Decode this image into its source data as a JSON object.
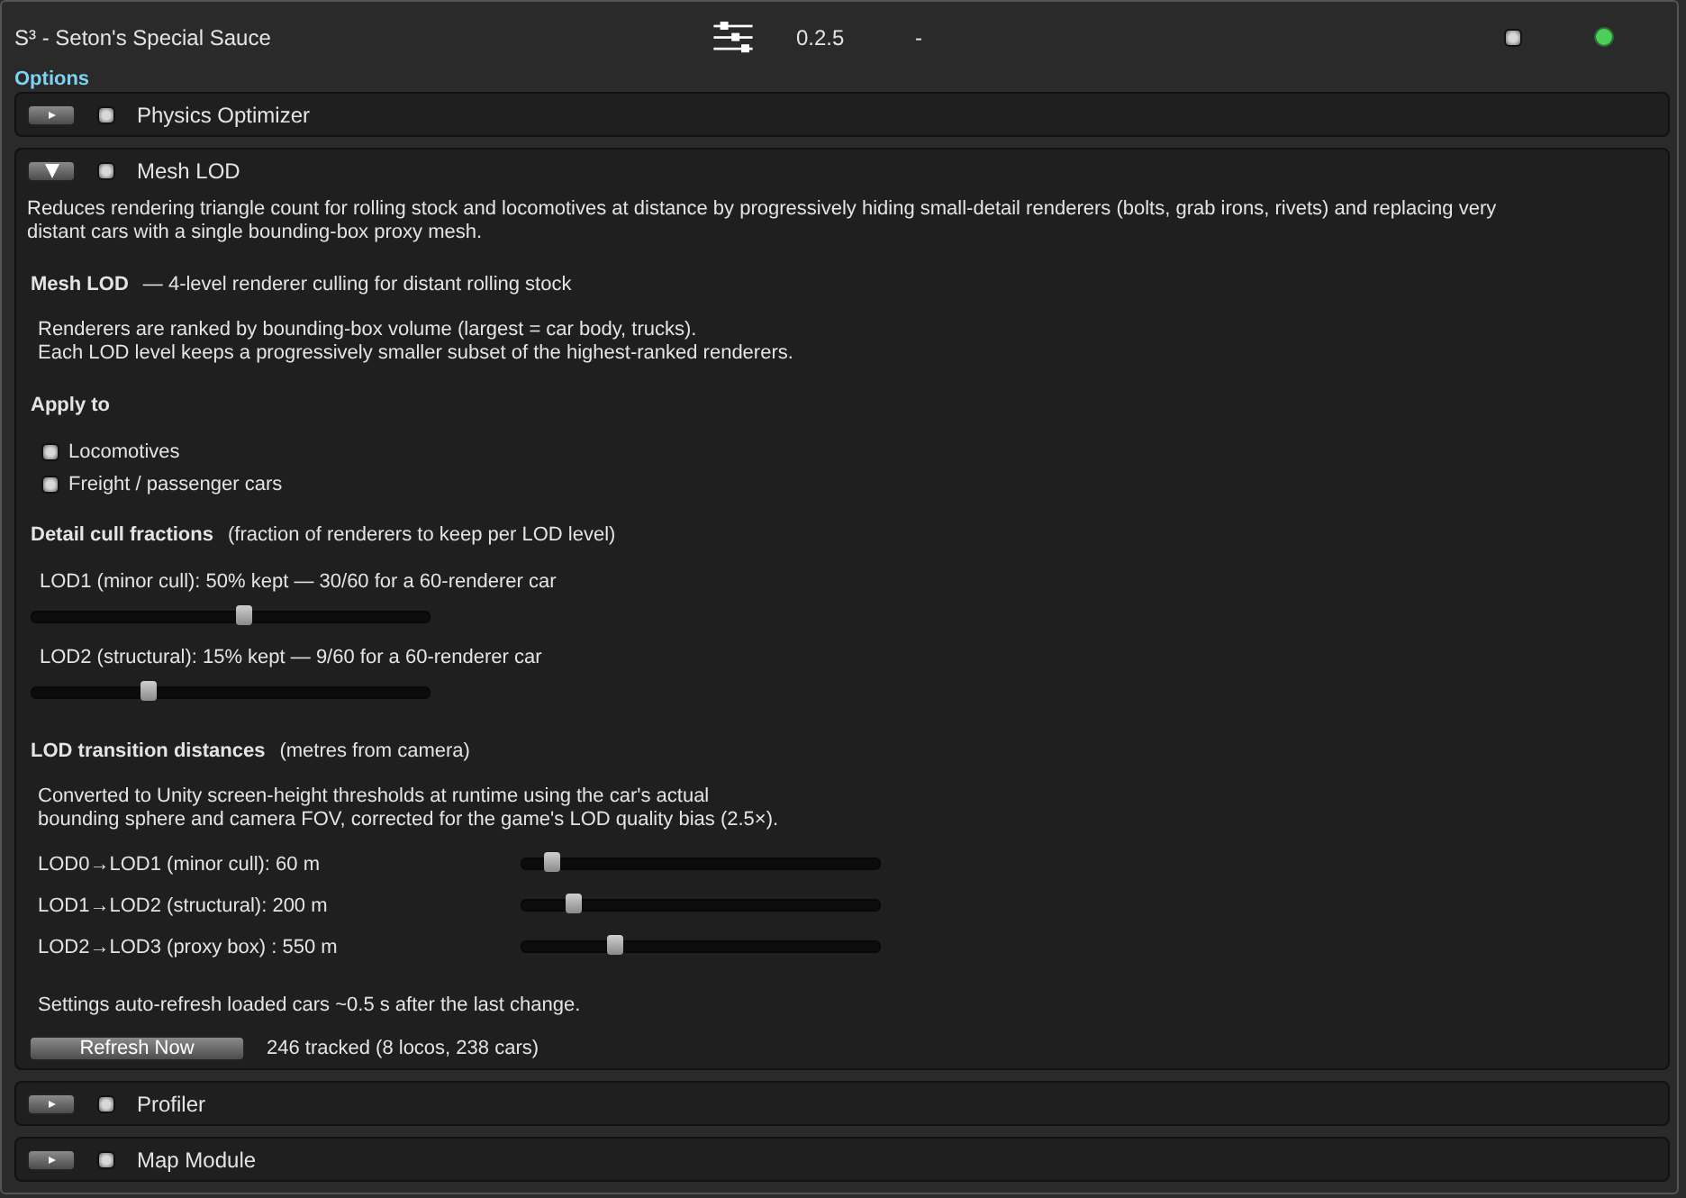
{
  "mod": {
    "title": "S³ - Seton's Special Sauce",
    "version": "0.2.5",
    "column_4": "-",
    "enabled": true,
    "active": true
  },
  "options_label": "Options",
  "sections": [
    {
      "title": "Physics Optimizer",
      "expanded": false,
      "enabled": true
    },
    {
      "title": "Mesh LOD",
      "expanded": true,
      "enabled": true,
      "description": "Reduces rendering triangle count for rolling stock and locomotives at distance by progressively hiding small-detail renderers (bolts, grab irons, rivets) and replacing very distant cars with a single bounding-box proxy mesh.",
      "content": {
        "heading": {
          "title": "Mesh LOD",
          "subtitle": "— 4-level renderer culling for distant rolling stock"
        },
        "notes": [
          "Renderers are ranked by bounding-box volume (largest = car body, trucks).",
          "Each LOD level keeps a progressively smaller subset of the highest-ranked renderers."
        ],
        "apply_to": {
          "title": "Apply to",
          "options": [
            {
              "label": "Locomotives",
              "checked": true
            },
            {
              "label": "Freight / passenger cars",
              "checked": true
            }
          ]
        },
        "cull": {
          "title": "Detail cull fractions",
          "subtitle": "(fraction of renderers to keep per LOD level)",
          "sliders": [
            {
              "label": "LOD1 (minor cull):  50% kept — 30/60 for a 60-renderer car",
              "level": 0.54
            },
            {
              "label": "LOD2 (structural):  15% kept — 9/60 for a 60-renderer car",
              "level": 0.3
            }
          ]
        },
        "distances": {
          "title": "LOD transition distances",
          "subtitle": "(metres from camera)",
          "notes": [
            "Converted to Unity screen-height thresholds at runtime using the car's actual",
            "bounding sphere and camera FOV, corrected for the game's LOD quality bias (2.5×)."
          ],
          "sliders": [
            {
              "label": "LOD0→LOD1  (minor cull):  60 m",
              "level": 0.09
            },
            {
              "label": "LOD1→LOD2  (structural):  200 m",
              "level": 0.15
            },
            {
              "label": "LOD2→LOD3  (proxy box) :  550 m",
              "level": 0.27
            }
          ]
        },
        "footer_note": "Settings auto-refresh loaded cars ~0.5 s after the last change.",
        "refresh_button": "Refresh Now",
        "tracked": "246 tracked  (8 locos, 238 cars)"
      }
    },
    {
      "title": "Profiler",
      "expanded": false,
      "enabled": true
    },
    {
      "title": "Map Module",
      "expanded": false,
      "enabled": true
    }
  ]
}
